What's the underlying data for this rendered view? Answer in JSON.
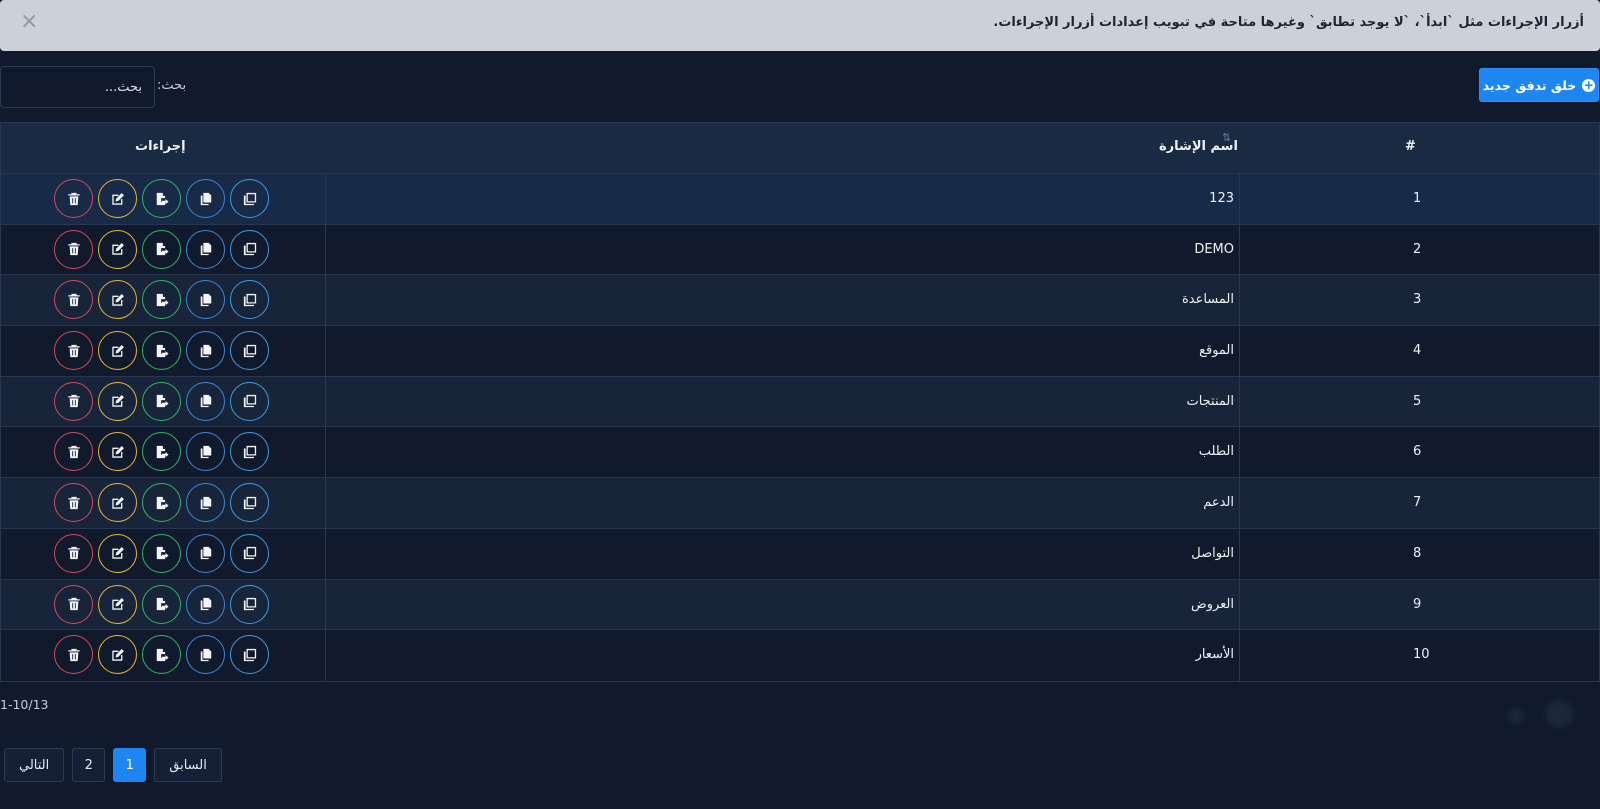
{
  "alert": {
    "text": "أزرار الإجراءات مثل `ابدأ`، `لا يوجد تطابق` وغيرها متاحة في تبويب إعدادات أزرار الإجراءات.",
    "close": "×"
  },
  "toolbar": {
    "create_label": "خلق تدفق جديد",
    "search_label": "بحث:",
    "search_placeholder": "بحث..."
  },
  "table": {
    "headers": {
      "index": "#",
      "name": "اسم الإشارة",
      "actions": "إجراءات"
    },
    "rows": [
      {
        "index": "1",
        "name": "123"
      },
      {
        "index": "2",
        "name": "DEMO"
      },
      {
        "index": "3",
        "name": "المساعدة"
      },
      {
        "index": "4",
        "name": "الموقع"
      },
      {
        "index": "5",
        "name": "المنتجات"
      },
      {
        "index": "6",
        "name": "الطلب"
      },
      {
        "index": "7",
        "name": "الدعم"
      },
      {
        "index": "8",
        "name": "التواصل"
      },
      {
        "index": "9",
        "name": "العروض"
      },
      {
        "index": "10",
        "name": "الأسعار"
      }
    ],
    "action_icons": [
      "delete-icon",
      "edit-icon",
      "export-file-icon",
      "copy-icon",
      "duplicate-icon"
    ]
  },
  "footer": {
    "range": "1-10/13",
    "pagination": {
      "next": "التالي",
      "pages": [
        "2",
        "1"
      ],
      "prev": "السابق",
      "active_page": "1"
    }
  },
  "colors": {
    "accent": "#1e86f0",
    "delete": "#d6485e",
    "edit": "#e6b535",
    "export": "#2fb567",
    "copy": "#3d87d6"
  }
}
